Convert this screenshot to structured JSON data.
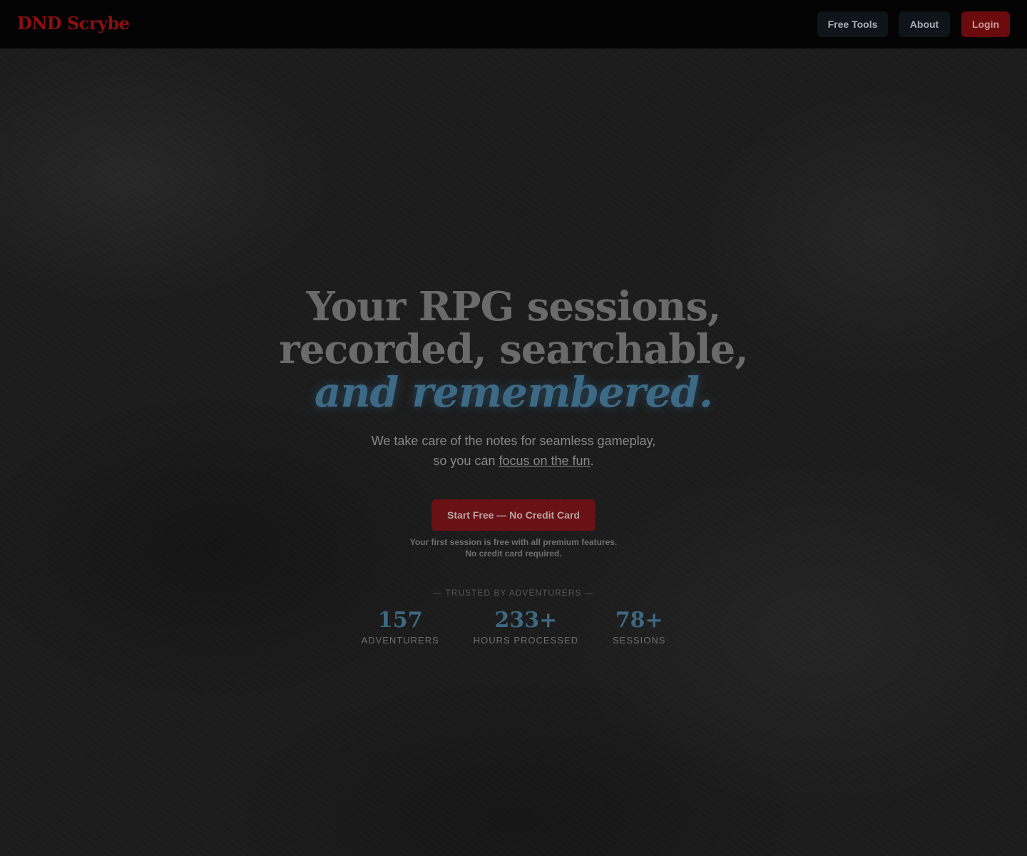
{
  "nav": {
    "logo": "DND Scrybe",
    "free_tools": "Free Tools",
    "about": "About",
    "login": "Login"
  },
  "hero": {
    "title_line1": "Your RPG sessions,",
    "title_line2": "recorded, searchable,",
    "title_accent": "and remembered.",
    "subtitle_line1": "We take care of the notes for seamless gameplay,",
    "subtitle_line2_prefix": "so you can ",
    "subtitle_link": "focus on the fun",
    "subtitle_line2_suffix": ".",
    "cta_label": "Start Free — No Credit Card",
    "note_line1": "Your first session is free with all premium features.",
    "note_line2": "No credit card required.",
    "trusted_label": "— TRUSTED BY ADVENTURERS —",
    "stats": [
      {
        "value": "157",
        "label": "ADVENTURERS"
      },
      {
        "value": "233+",
        "label": "HOURS PROCESSED"
      },
      {
        "value": "78+",
        "label": "SESSIONS"
      }
    ]
  },
  "colors": {
    "brand_red": "#8c0f10",
    "accent_blue": "#3c6a86",
    "nav_bg": "#030303"
  }
}
